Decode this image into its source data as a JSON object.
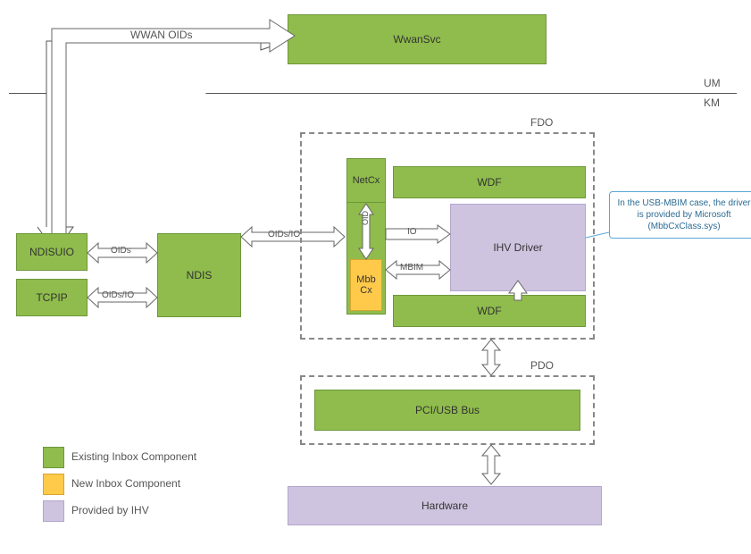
{
  "top": {
    "wwan_oids": "WWAN OIDs",
    "wwansvc": "WwanSvc"
  },
  "mode": {
    "um": "UM",
    "km": "KM"
  },
  "left": {
    "ndisuio": "NDISUIO",
    "tcpip": "TCPIP",
    "ndis": "NDIS",
    "oids": "OIDs",
    "oids_io": "OIDs/IO"
  },
  "fdo": {
    "label": "FDO",
    "netcx": "NetCx",
    "wdf_top": "WDF",
    "wdf_bot": "WDF",
    "mbbcx": "Mbb\nCx",
    "ihv": "IHV Driver",
    "io": "IO",
    "mbim": "MBIM",
    "oid": "OID",
    "oids_io": "OIDs/IO"
  },
  "pdo": {
    "label": "PDO",
    "bus": "PCI/USB Bus"
  },
  "hardware": "Hardware",
  "callout": "In the USB-MBIM case, the driver is provided by Microsoft (MbbCxClass.sys)",
  "legend": {
    "existing": "Existing Inbox Component",
    "newc": "New Inbox Component",
    "ihv": "Provided by IHV"
  }
}
